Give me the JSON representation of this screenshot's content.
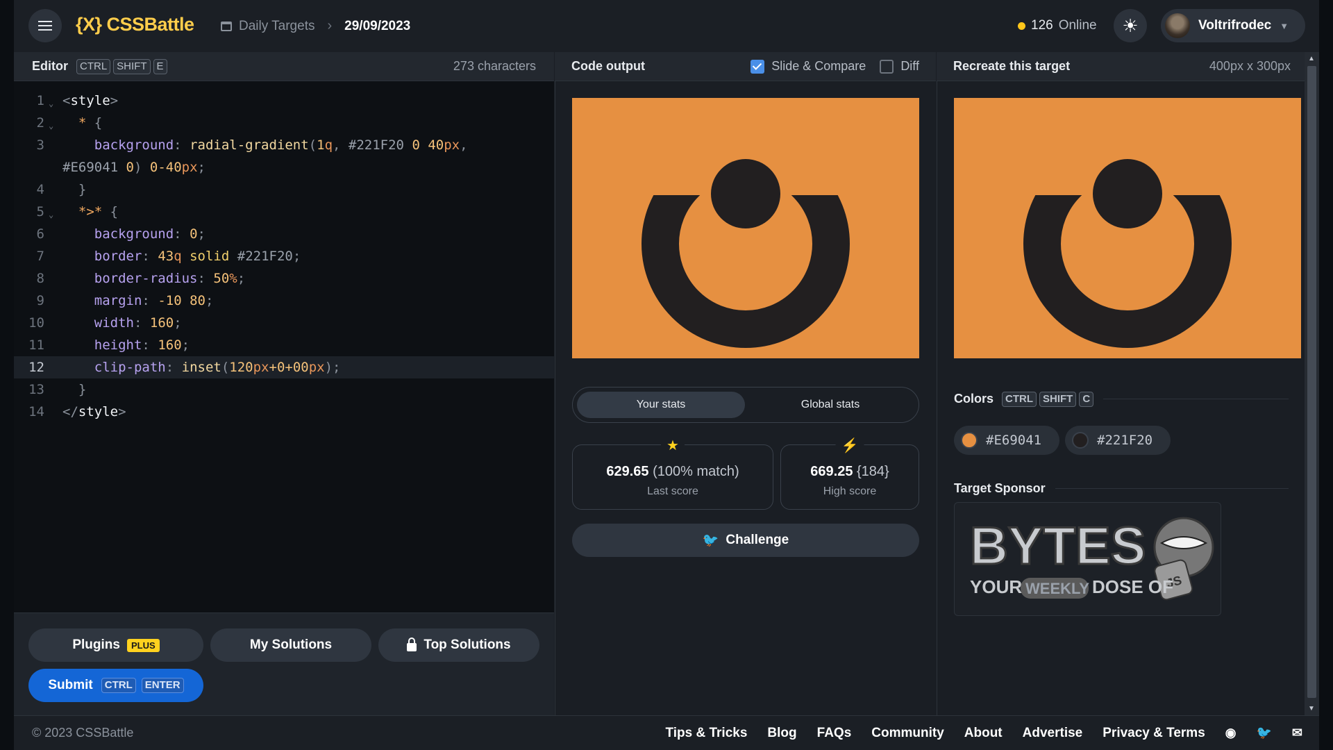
{
  "header": {
    "logo": "{X} CSSBattle",
    "section": "Daily Targets",
    "date": "29/09/2023",
    "online_count": "126",
    "online_label": "Online",
    "username": "Voltrifrodec"
  },
  "editor": {
    "title": "Editor",
    "shortcut": [
      "CTRL",
      "SHIFT",
      "E"
    ],
    "char_count": "273 characters",
    "lines": [
      "1",
      "2",
      "3",
      "",
      "4",
      "5",
      "6",
      "7",
      "8",
      "9",
      "10",
      "11",
      "12",
      "13",
      "14"
    ]
  },
  "output": {
    "title": "Code output",
    "slide_compare": "Slide & Compare",
    "slide_compare_checked": true,
    "diff": "Diff",
    "diff_checked": false,
    "tab_your": "Your stats",
    "tab_global": "Global stats",
    "last_score": "629.65",
    "last_match": "(100% match)",
    "last_label": "Last score",
    "high_score": "669.25",
    "high_chars": "{184}",
    "high_label": "High score",
    "challenge": "Challenge"
  },
  "target": {
    "title": "Recreate this target",
    "size": "400px x 300px",
    "colors_title": "Colors",
    "colors_shortcut": [
      "CTRL",
      "SHIFT",
      "C"
    ],
    "colors": [
      {
        "hex": "#E69041"
      },
      {
        "hex": "#221F20"
      }
    ],
    "sponsor_title": "Target Sponsor",
    "sponsor_word": "BYTES",
    "sponsor_tag1": "YOUR",
    "sponsor_tag2": "WEEKLY",
    "sponsor_tag3": "DOSE OF",
    "sponsor_badge": "JS"
  },
  "actions": {
    "plugins": "Plugins",
    "plus": "PLUS",
    "my_solutions": "My Solutions",
    "top_solutions": "Top Solutions",
    "submit": "Submit",
    "submit_kbd": [
      "CTRL",
      "ENTER"
    ]
  },
  "footer": {
    "copyright": "© 2023 CSSBattle",
    "links": [
      "Tips & Tricks",
      "Blog",
      "FAQs",
      "Community",
      "About",
      "Advertise",
      "Privacy & Terms"
    ]
  }
}
